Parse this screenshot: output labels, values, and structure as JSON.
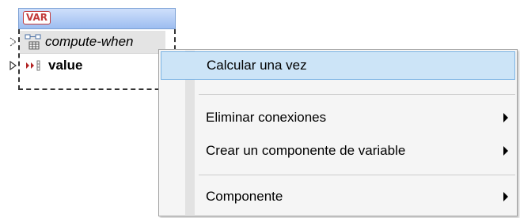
{
  "component": {
    "badge": "VAR",
    "rows": [
      {
        "label": "compute-when",
        "icon": "parameter-icon"
      },
      {
        "label": "value",
        "icon": "value-output-icon"
      }
    ]
  },
  "context_menu": {
    "items": [
      {
        "label": "Calcular una vez",
        "highlighted": true,
        "has_submenu": false
      },
      {
        "label": "Eliminar conexiones",
        "highlighted": false,
        "has_submenu": true
      },
      {
        "label": "Crear un componente de variable",
        "highlighted": false,
        "has_submenu": true
      },
      {
        "label": "Componente",
        "highlighted": false,
        "has_submenu": true
      }
    ]
  },
  "colors": {
    "header_gradient_top": "#cfe0fb",
    "header_gradient_bottom": "#9dbdf0",
    "badge_red": "#c23b3b",
    "menu_highlight": "#cce4f7",
    "menu_highlight_border": "#7bb3e4"
  }
}
